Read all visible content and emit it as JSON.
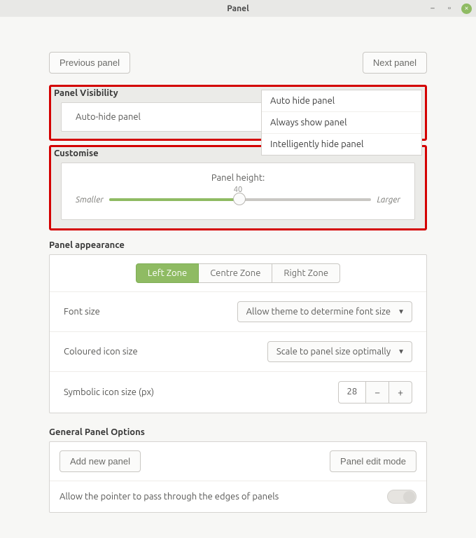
{
  "window": {
    "title": "Panel"
  },
  "nav": {
    "prev": "Previous panel",
    "next": "Next panel"
  },
  "visibility": {
    "header": "Panel Visibility",
    "row_label": "Auto-hide panel",
    "options": {
      "auto_hide": "Auto hide panel",
      "always_show": "Always show panel",
      "intelligent": "Intelligently hide panel"
    }
  },
  "customise": {
    "header": "Customise",
    "slider_label": "Panel height:",
    "value": "40",
    "min_label": "Smaller",
    "max_label": "Larger"
  },
  "appearance": {
    "header": "Panel appearance",
    "zones": {
      "left": "Left Zone",
      "centre": "Centre Zone",
      "right": "Right Zone"
    },
    "font_size": {
      "label": "Font size",
      "value": "Allow theme to determine font size"
    },
    "coloured_icon": {
      "label": "Coloured icon size",
      "value": "Scale to panel size optimally"
    },
    "symbolic_icon": {
      "label": "Symbolic icon size (px)",
      "value": "28"
    }
  },
  "general": {
    "header": "General Panel Options",
    "add_panel": "Add new panel",
    "edit_mode": "Panel edit mode",
    "pointer_edges": "Allow the pointer to pass through the edges of panels"
  }
}
